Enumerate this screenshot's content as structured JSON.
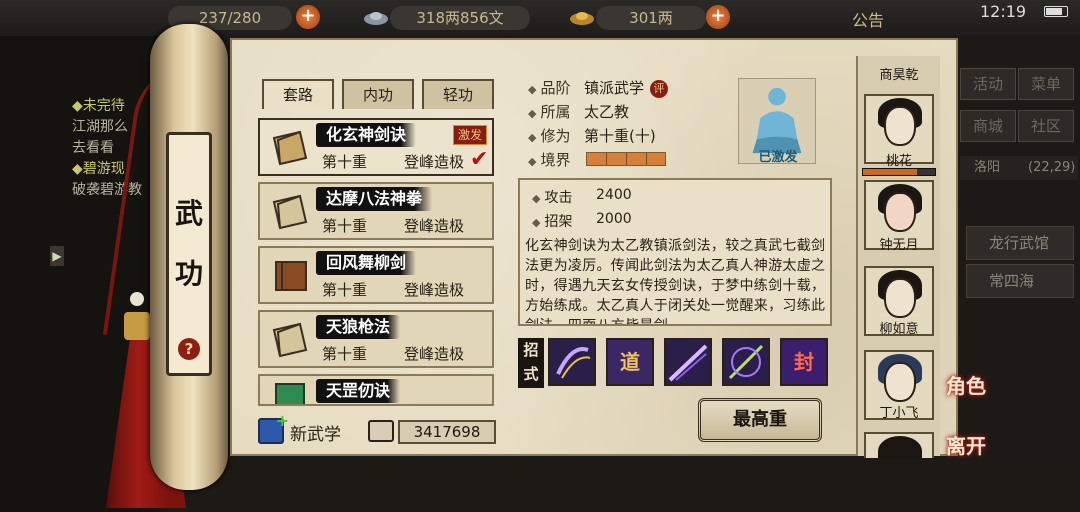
{
  "topbar": {
    "res1": "237/280",
    "res2": "318两856文",
    "res3": "301两",
    "notice": "公告",
    "clock": "12:19"
  },
  "quests": {
    "q1_title": "未完待",
    "q1_line1": "江湖那么",
    "q1_line2": "去看看",
    "q2_title": "碧游现",
    "q2_line1": "破袭碧游教"
  },
  "right_menu": {
    "activity": "活动",
    "menu": "菜单",
    "mall": "商城",
    "community": "社区",
    "city": "洛阳",
    "coords": "(22,29)",
    "item1": "龙行武馆",
    "item2": "常四海"
  },
  "scroll": {
    "title": "武功",
    "help": "?"
  },
  "tabs": [
    "套路",
    "内功",
    "轻功"
  ],
  "skills": [
    {
      "name": "化玄神剑诀",
      "level": "第十重",
      "grade": "登峰造极",
      "badge": "激发",
      "checked": true
    },
    {
      "name": "达摩八法神拳",
      "level": "第十重",
      "grade": "登峰造极"
    },
    {
      "name": "回风舞柳剑",
      "level": "第十重",
      "grade": "登峰造极"
    },
    {
      "name": "天狼枪法",
      "level": "第十重",
      "grade": "登峰造极"
    },
    {
      "name": "天罡仞诀",
      "level": "",
      "grade": ""
    }
  ],
  "footer": {
    "new_label": "新武学",
    "points": "3417698"
  },
  "info": {
    "rank_key": "品阶",
    "rank_val": "镇派武学",
    "rank_tag": "评",
    "sect_key": "所属",
    "sect_val": "太乙教",
    "cult_key": "修为",
    "cult_val": "第十重(十)",
    "realm_key": "境界",
    "realm_segments_filled": 4,
    "realm_segments_total": 4,
    "portrait_label": "已激发"
  },
  "stats": {
    "attack_key": "攻击",
    "attack_val": "2400",
    "parry_key": "招架",
    "parry_val": "2000"
  },
  "description": "化玄神剑诀为太乙教镇派剑法，较之真武七截剑法更为凌厉。传闻此剑法为太乙真人神游太虚之时，得遇九天玄女传授剑诀，于梦中练剑十载，方始练成。太乙真人于闭关处一觉醒来，习练此剑法，四面八方皆是剑",
  "moves": {
    "label": "招式",
    "glyphs": [
      "",
      "道",
      "",
      "",
      "封"
    ]
  },
  "max_button": "最高重",
  "companions": [
    {
      "name": "商昊乾"
    },
    {
      "name": "桃花"
    },
    {
      "name": "钟无月"
    },
    {
      "name": "柳如意"
    },
    {
      "name": "丁小飞"
    }
  ],
  "companion_hp_fraction": 0.75,
  "side_buttons": {
    "role": "角色",
    "leave": "离开"
  }
}
